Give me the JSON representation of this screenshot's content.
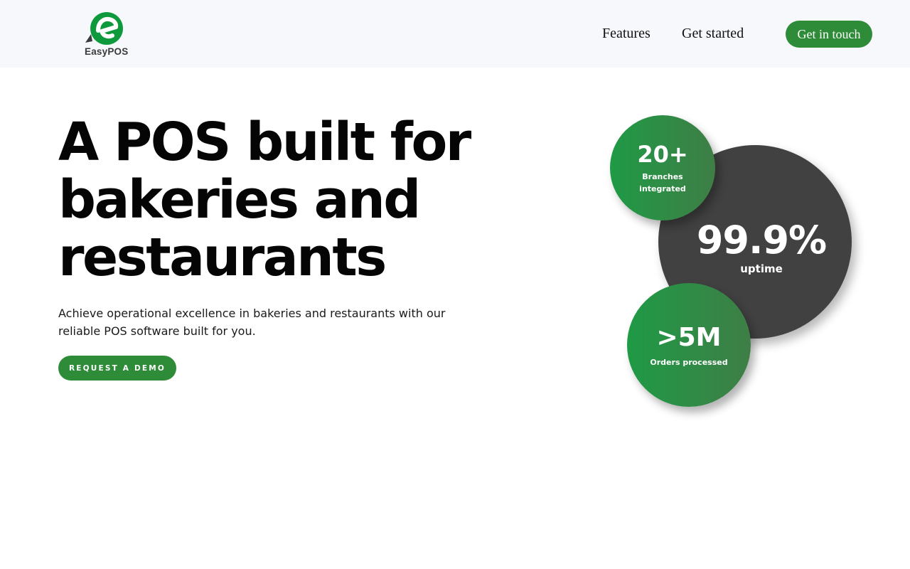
{
  "nav": {
    "logo_text": "EasyPOS",
    "links": [
      "Features",
      "Get started"
    ],
    "cta_label": "Get in touch"
  },
  "hero": {
    "title": "A POS built for bakeries and restaurants",
    "subtitle": "Achieve operational excellence in bakeries and restaurants with our reliable POS software built for you.",
    "button_label": "REQUEST A DEMO"
  },
  "stats": {
    "uptime": {
      "value": "99.9%",
      "label": "uptime"
    },
    "branches": {
      "value": "20+",
      "label": "Branches integrated"
    },
    "orders": {
      "value": ">5M",
      "label": "Orders processed"
    }
  },
  "colors": {
    "brand_green": "#2e8b38",
    "nav_background": "#f7f8fc",
    "dark_circle": "#414141"
  },
  "icons": {
    "logo": "easypos-e-logo-icon"
  }
}
